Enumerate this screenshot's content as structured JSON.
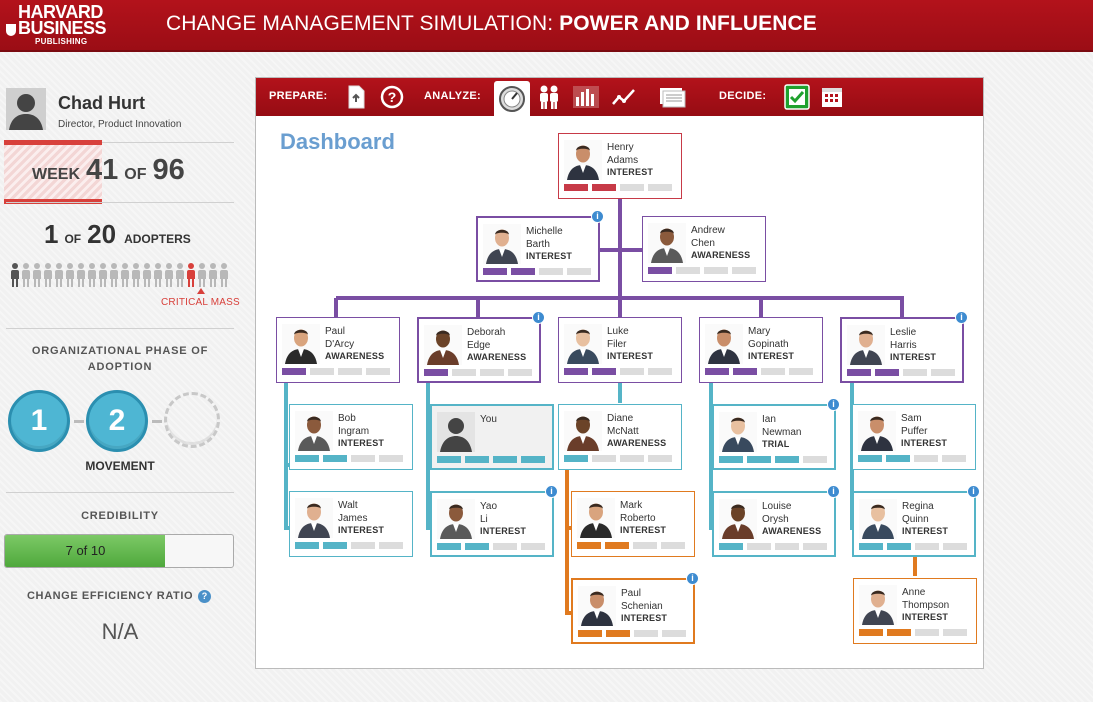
{
  "header": {
    "logo_line1": "HARVARD",
    "logo_line2": "BUSINESS",
    "logo_line3": "PUBLISHING",
    "title_prefix": "CHANGE MANAGEMENT SIMULATION: ",
    "title_bold": "POWER AND INFLUENCE"
  },
  "user": {
    "name": "Chad Hurt",
    "role": "Director, Product Innovation"
  },
  "week": {
    "label": "WEEK",
    "current": "41",
    "of": "OF",
    "total": "96"
  },
  "adopters": {
    "current": "1",
    "of": "OF",
    "total": "20",
    "label": "ADOPTERS",
    "critical_label": "CRITICAL MASS"
  },
  "phase": {
    "title": "ORGANIZATIONAL PHASE OF ADOPTION",
    "step1": "1",
    "step2": "2",
    "current_name": "MOVEMENT"
  },
  "credibility": {
    "title": "CREDIBILITY",
    "label": "7 of 10",
    "value": 7,
    "max": 10
  },
  "cer": {
    "title": "CHANGE EFFICIENCY RATIO",
    "help": "?",
    "value": "N/A"
  },
  "toolbar": {
    "prepare": "PREPARE:",
    "analyze": "ANALYZE:",
    "decide": "DECIDE:"
  },
  "main": {
    "title": "Dashboard"
  },
  "colors": {
    "brand": "#a8101a",
    "t1": "#c73a47",
    "t2": "#7a4ea3",
    "t3": "#55b4c7",
    "t4": "#e07a1f",
    "seg_empty": "#dcdcdc",
    "seg_green": "#1fa12e"
  },
  "people": {
    "henry": {
      "first": "Henry",
      "last": "Adams",
      "status": "INTEREST",
      "level": 2,
      "tier": "t1"
    },
    "michelle": {
      "first": "Michelle",
      "last": "Barth",
      "status": "INTEREST",
      "level": 2,
      "tier": "t2"
    },
    "andrew": {
      "first": "Andrew",
      "last": "Chen",
      "status": "AWARENESS",
      "level": 1,
      "tier": "t2"
    },
    "paul_d": {
      "first": "Paul",
      "last": "D'Arcy",
      "status": "AWARENESS",
      "level": 1,
      "tier": "t2"
    },
    "deborah": {
      "first": "Deborah",
      "last": "Edge",
      "status": "AWARENESS",
      "level": 1,
      "tier": "t2"
    },
    "luke": {
      "first": "Luke",
      "last": "Filer",
      "status": "INTEREST",
      "level": 2,
      "tier": "t2"
    },
    "mary": {
      "first": "Mary",
      "last": "Gopinath",
      "status": "INTEREST",
      "level": 2,
      "tier": "t2"
    },
    "leslie": {
      "first": "Leslie",
      "last": "Harris",
      "status": "INTEREST",
      "level": 2,
      "tier": "t2"
    },
    "bob": {
      "first": "Bob",
      "last": "Ingram",
      "status": "INTEREST",
      "level": 2,
      "tier": "t3"
    },
    "you": {
      "first": "You",
      "last": "",
      "status": "",
      "level": 4,
      "tier": "t3"
    },
    "diane": {
      "first": "Diane",
      "last": "McNatt",
      "status": "AWARENESS",
      "level": 1,
      "tier": "t3"
    },
    "ian": {
      "first": "Ian",
      "last": "Newman",
      "status": "TRIAL",
      "level": 3,
      "tier": "t3"
    },
    "sam": {
      "first": "Sam",
      "last": "Puffer",
      "status": "INTEREST",
      "level": 2,
      "tier": "t3"
    },
    "walt": {
      "first": "Walt",
      "last": "James",
      "status": "INTEREST",
      "level": 2,
      "tier": "t3"
    },
    "yao": {
      "first": "Yao",
      "last": "Li",
      "status": "INTEREST",
      "level": 2,
      "tier": "t3"
    },
    "mark": {
      "first": "Mark",
      "last": "Roberto",
      "status": "INTEREST",
      "level": 2,
      "tier": "t4"
    },
    "louise": {
      "first": "Louise",
      "last": "Orysh",
      "status": "AWARENESS",
      "level": 1,
      "tier": "t3"
    },
    "regina": {
      "first": "Regina",
      "last": "Quinn",
      "status": "INTEREST",
      "level": 2,
      "tier": "t3"
    },
    "paul_s": {
      "first": "Paul",
      "last": "Schenian",
      "status": "INTEREST",
      "level": 2,
      "tier": "t4"
    },
    "anne": {
      "first": "Anne",
      "last": "Thompson",
      "status": "INTEREST",
      "level": 2,
      "tier": "t4"
    }
  }
}
